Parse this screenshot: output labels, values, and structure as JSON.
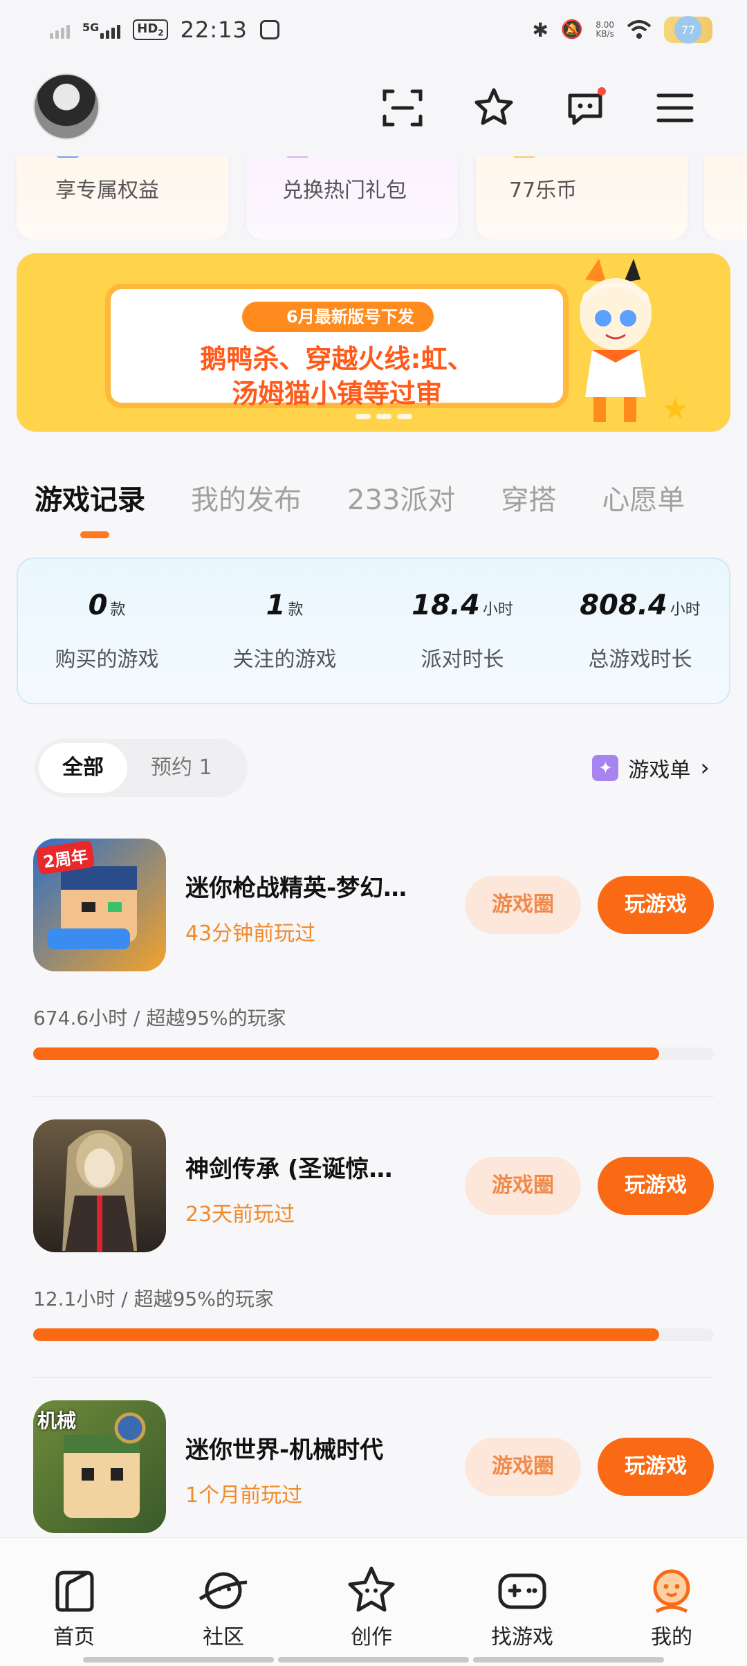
{
  "status_bar": {
    "network": "5G",
    "hd_label": "HD",
    "hd_sub": "2",
    "time": "22:13",
    "speed_value": "8.00",
    "speed_unit": "KB/s",
    "battery": "77"
  },
  "perks": [
    {
      "label": "享专属权益",
      "color": "#3a7cf0"
    },
    {
      "label": "兑换热门礼包",
      "color": "#c79af0"
    },
    {
      "label": "77乐币",
      "color": "#f5b832"
    }
  ],
  "banner": {
    "tag": "6月最新版号下发",
    "line1": "鹅鸭杀、穿越火线:虹、",
    "line2": "汤姆猫小镇等过审"
  },
  "tabs": [
    {
      "label": "游戏记录",
      "active": true
    },
    {
      "label": "我的发布",
      "active": false
    },
    {
      "label": "233派对",
      "active": false
    },
    {
      "label": "穿搭",
      "active": false
    },
    {
      "label": "心愿单",
      "active": false
    }
  ],
  "stats": [
    {
      "value": "0",
      "unit": "款",
      "label": "购买的游戏"
    },
    {
      "value": "1",
      "unit": "款",
      "label": "关注的游戏"
    },
    {
      "value": "18.4",
      "unit": "小时",
      "label": "派对时长"
    },
    {
      "value": "808.4",
      "unit": "小时",
      "label": "总游戏时长"
    }
  ],
  "filter": {
    "all": "全部",
    "reserve": "预约 1"
  },
  "gamelist_label": "游戏单",
  "games": [
    {
      "name": "迷你枪战精英-梦幻…",
      "last_played": "43分钟前玩过",
      "stat": "674.6小时 / 超越95%的玩家",
      "progress": 0.92,
      "circle_btn": "游戏圈",
      "play_btn": "玩游戏",
      "icon_badge": "2周年"
    },
    {
      "name": "神剑传承 (圣诞惊…",
      "last_played": "23天前玩过",
      "stat": "12.1小时 / 超越95%的玩家",
      "progress": 0.92,
      "circle_btn": "游戏圈",
      "play_btn": "玩游戏",
      "icon_badge": ""
    },
    {
      "name": "迷你世界-机械时代",
      "last_played": "1个月前玩过",
      "stat": "",
      "progress": 0,
      "circle_btn": "游戏圈",
      "play_btn": "玩游戏",
      "icon_badge": "机械"
    }
  ],
  "bottom_nav": [
    {
      "label": "首页",
      "icon": "home-icon"
    },
    {
      "label": "社区",
      "icon": "planet-icon"
    },
    {
      "label": "创作",
      "icon": "star-icon"
    },
    {
      "label": "找游戏",
      "icon": "gamepad-icon"
    },
    {
      "label": "我的",
      "icon": "profile-icon"
    }
  ],
  "colors": {
    "accent": "#fa6a14",
    "accent_light": "#fde7db",
    "banner_bg": "#ffd44a"
  }
}
